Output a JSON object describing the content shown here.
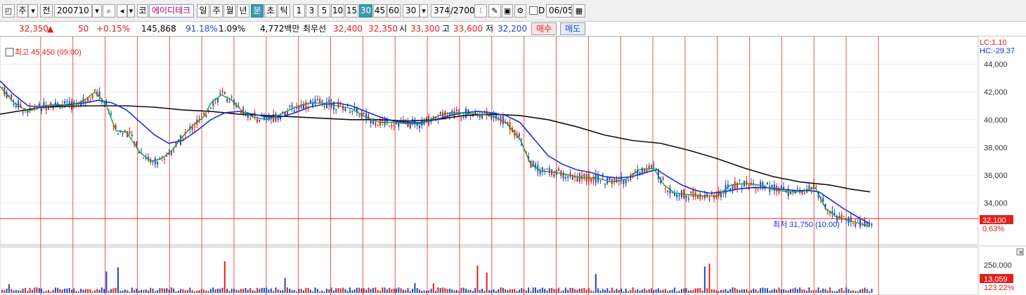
{
  "toolbar": {
    "market_type": "주",
    "prev_label": "전",
    "code": "200710",
    "search_icon": "search-icon",
    "sound_icon": "speaker-icon",
    "market_badge": "코",
    "stock_name": "에이디테크",
    "periods": [
      "일",
      "주",
      "월",
      "년",
      "분",
      "초",
      "틱"
    ],
    "selected_period": "분",
    "intervals": [
      "1",
      "3",
      "5",
      "10",
      "15",
      "30",
      "45",
      "60"
    ],
    "selected_interval": "30",
    "interval_value": "30",
    "count_value": "374",
    "count_total": "/2700",
    "checkbox_label": "D",
    "date_value": "06/05"
  },
  "quote": {
    "price": "32,350",
    "change_arrow": "▲",
    "change": "50",
    "change_rate": "+0.15%",
    "volume": "145,868",
    "volume_ratio": "91.18%",
    "turnover_rate": "1.09%",
    "amount": "4,772백만",
    "best_label": "최우선",
    "best_ask": "32,400",
    "best_bid": "32,350",
    "open_label": "시",
    "open": "33,300",
    "high_label": "고",
    "high": "33,600",
    "low_label": "저",
    "low": "32,200",
    "buy_button": "매수",
    "sell_button": "매도"
  },
  "chart_data": {
    "type": "candlestick",
    "price_axis": {
      "min": 31000,
      "max": 46000,
      "ticks": [
        "44,000",
        "42,000",
        "40,000",
        "38,000",
        "36,000",
        "34,000"
      ]
    },
    "volume_axis": {
      "ticks": [
        "250,000"
      ]
    },
    "lc_label": "LC:1.10",
    "hc_label": "HC:-29.37",
    "high_marker": "최고 45,450 (09:00)",
    "low_marker": "최저 31,750 (10:00)",
    "current_price": "32,100",
    "current_rate": "0.63%",
    "volume_value": "13,059",
    "volume_rate": "123.22%",
    "ma_colors": {
      "ma_short": "#17a02a",
      "ma_mid": "#1530d8",
      "ma_long": "#111111"
    },
    "ma_short": [
      [
        0,
        42400
      ],
      [
        20,
        41200
      ],
      [
        40,
        40600
      ],
      [
        60,
        41000
      ],
      [
        80,
        41100
      ],
      [
        100,
        41000
      ],
      [
        120,
        41400
      ],
      [
        135,
        42000
      ],
      [
        150,
        41200
      ],
      [
        165,
        39200
      ],
      [
        180,
        39100
      ],
      [
        200,
        37600
      ],
      [
        215,
        37000
      ],
      [
        230,
        37200
      ],
      [
        245,
        37800
      ],
      [
        260,
        38800
      ],
      [
        275,
        39600
      ],
      [
        290,
        40200
      ],
      [
        300,
        41200
      ],
      [
        315,
        41800
      ],
      [
        330,
        41400
      ],
      [
        345,
        40600
      ],
      [
        360,
        40200
      ],
      [
        380,
        40000
      ],
      [
        400,
        40400
      ],
      [
        420,
        40900
      ],
      [
        440,
        41200
      ],
      [
        460,
        41200
      ],
      [
        480,
        41000
      ],
      [
        500,
        40800
      ],
      [
        520,
        40200
      ],
      [
        540,
        39800
      ],
      [
        560,
        39800
      ],
      [
        580,
        39700
      ],
      [
        600,
        39700
      ],
      [
        620,
        40200
      ],
      [
        640,
        40500
      ],
      [
        660,
        40500
      ],
      [
        680,
        40400
      ],
      [
        700,
        40300
      ],
      [
        720,
        39800
      ],
      [
        740,
        38600
      ],
      [
        755,
        36800
      ],
      [
        770,
        36300
      ],
      [
        790,
        36200
      ],
      [
        810,
        36000
      ],
      [
        830,
        35800
      ],
      [
        850,
        35800
      ],
      [
        870,
        35500
      ],
      [
        890,
        35700
      ],
      [
        910,
        36400
      ],
      [
        930,
        36500
      ],
      [
        945,
        35300
      ],
      [
        960,
        34700
      ],
      [
        980,
        34600
      ],
      [
        1000,
        34500
      ],
      [
        1020,
        34500
      ],
      [
        1040,
        35300
      ],
      [
        1060,
        35400
      ],
      [
        1080,
        35300
      ],
      [
        1100,
        35000
      ],
      [
        1120,
        34800
      ],
      [
        1140,
        34800
      ],
      [
        1160,
        35100
      ],
      [
        1175,
        33600
      ],
      [
        1190,
        33000
      ],
      [
        1210,
        32700
      ],
      [
        1225,
        32500
      ],
      [
        1238,
        32300
      ]
    ],
    "ma_mid": [
      [
        0,
        42800
      ],
      [
        20,
        41800
      ],
      [
        40,
        41000
      ],
      [
        60,
        40900
      ],
      [
        80,
        41000
      ],
      [
        100,
        41100
      ],
      [
        120,
        41200
      ],
      [
        140,
        41400
      ],
      [
        160,
        41200
      ],
      [
        180,
        40700
      ],
      [
        200,
        39800
      ],
      [
        220,
        38900
      ],
      [
        240,
        38300
      ],
      [
        260,
        38500
      ],
      [
        280,
        39200
      ],
      [
        300,
        40000
      ],
      [
        320,
        40500
      ],
      [
        340,
        40600
      ],
      [
        360,
        40400
      ],
      [
        380,
        40200
      ],
      [
        400,
        40200
      ],
      [
        420,
        40500
      ],
      [
        440,
        40900
      ],
      [
        460,
        41100
      ],
      [
        480,
        41200
      ],
      [
        500,
        41000
      ],
      [
        520,
        40600
      ],
      [
        540,
        40200
      ],
      [
        560,
        39900
      ],
      [
        580,
        39800
      ],
      [
        600,
        39800
      ],
      [
        620,
        40000
      ],
      [
        640,
        40300
      ],
      [
        660,
        40500
      ],
      [
        680,
        40600
      ],
      [
        700,
        40500
      ],
      [
        720,
        40300
      ],
      [
        740,
        39800
      ],
      [
        760,
        38600
      ],
      [
        780,
        37400
      ],
      [
        800,
        36800
      ],
      [
        820,
        36400
      ],
      [
        840,
        36200
      ],
      [
        860,
        35900
      ],
      [
        880,
        35800
      ],
      [
        900,
        35900
      ],
      [
        920,
        36200
      ],
      [
        935,
        36400
      ],
      [
        950,
        35900
      ],
      [
        970,
        35300
      ],
      [
        990,
        34900
      ],
      [
        1010,
        34700
      ],
      [
        1030,
        34800
      ],
      [
        1050,
        35000
      ],
      [
        1070,
        35100
      ],
      [
        1090,
        35100
      ],
      [
        1110,
        35000
      ],
      [
        1130,
        34900
      ],
      [
        1150,
        34900
      ],
      [
        1165,
        34800
      ],
      [
        1180,
        34300
      ],
      [
        1200,
        33600
      ],
      [
        1220,
        33000
      ],
      [
        1238,
        32500
      ]
    ],
    "ma_long": [
      [
        0,
        40400
      ],
      [
        60,
        40900
      ],
      [
        120,
        41000
      ],
      [
        180,
        41000
      ],
      [
        220,
        40900
      ],
      [
        260,
        40700
      ],
      [
        300,
        40600
      ],
      [
        340,
        40400
      ],
      [
        380,
        40300
      ],
      [
        420,
        40200
      ],
      [
        460,
        40100
      ],
      [
        500,
        40000
      ],
      [
        540,
        40000
      ],
      [
        580,
        39900
      ],
      [
        620,
        40000
      ],
      [
        660,
        40300
      ],
      [
        700,
        40400
      ],
      [
        740,
        40300
      ],
      [
        780,
        40000
      ],
      [
        820,
        39500
      ],
      [
        860,
        38900
      ],
      [
        900,
        38500
      ],
      [
        940,
        38300
      ],
      [
        980,
        37800
      ],
      [
        1020,
        37200
      ],
      [
        1060,
        36500
      ],
      [
        1100,
        35900
      ],
      [
        1140,
        35500
      ],
      [
        1180,
        35300
      ],
      [
        1210,
        35000
      ],
      [
        1238,
        34800
      ]
    ]
  }
}
